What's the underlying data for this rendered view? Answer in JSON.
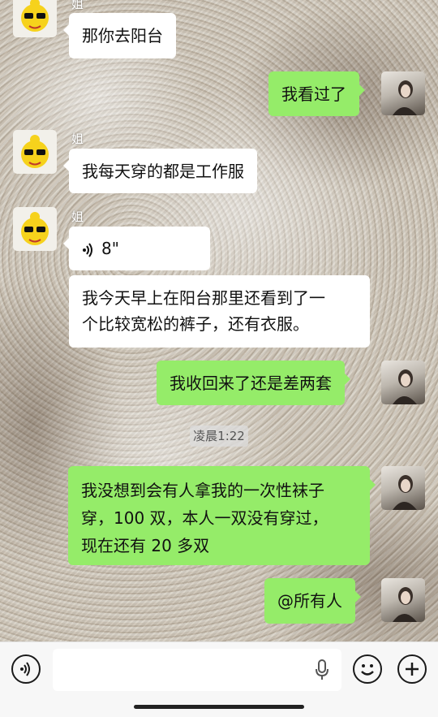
{
  "messages": [
    {
      "side": "in",
      "sender": "姐",
      "text": "那你去阳台"
    },
    {
      "side": "out",
      "text": "我看过了"
    },
    {
      "side": "in",
      "sender": "姐",
      "text": "我每天穿的都是工作服"
    },
    {
      "side": "in",
      "sender": "姐",
      "voice_duration": "8\""
    },
    {
      "side": "in",
      "lines": [
        "我今天早上在阳台那里还看到了一",
        "个比较宽松的裤子，还有衣服。"
      ]
    },
    {
      "side": "out",
      "text": "我收回来了还是差两套"
    },
    {
      "side": "out",
      "lines": [
        "我没想到会有人拿我的一次性袜子",
        "穿，100 双，本人一双没有穿过，",
        "现在还有 20 多双"
      ]
    },
    {
      "side": "out",
      "text": "@所有人"
    }
  ],
  "timestamp": "凌晨1:22",
  "input": {
    "value": "",
    "placeholder": ""
  },
  "colors": {
    "incoming_bubble": "#ffffff",
    "outgoing_bubble": "#95ec69",
    "bar": "#f7f7f7"
  },
  "icons": [
    "voice-mode-icon",
    "microphone-icon",
    "emoji-icon",
    "plus-icon"
  ]
}
